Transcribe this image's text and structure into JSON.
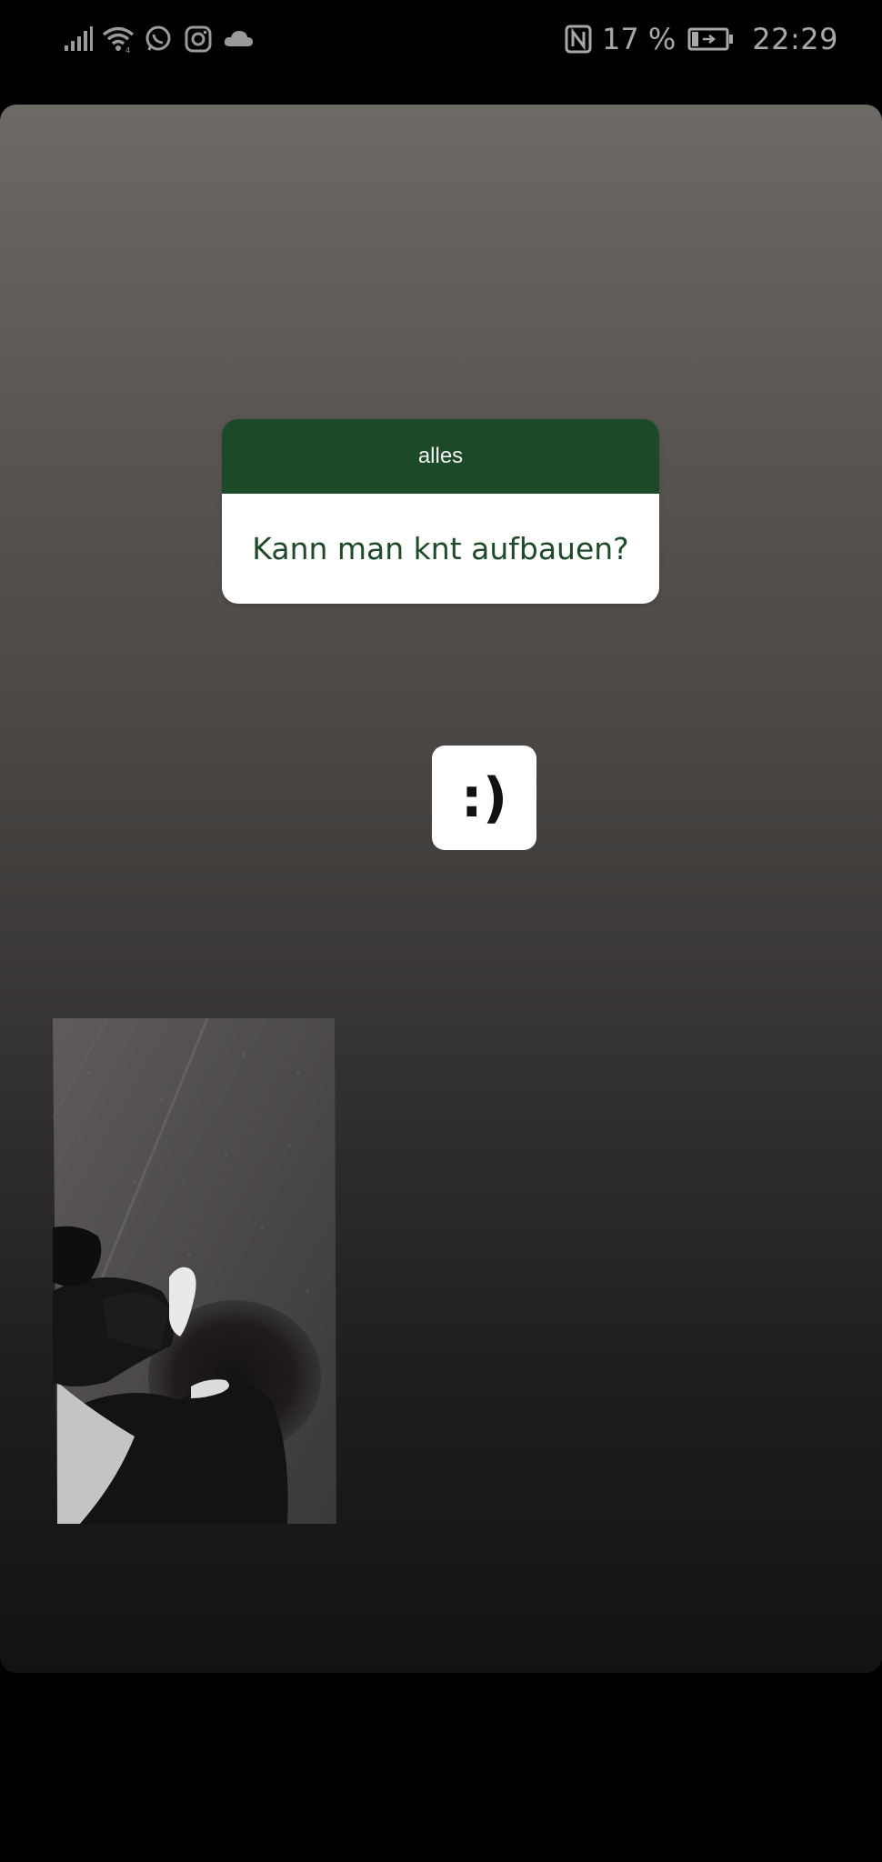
{
  "status_bar": {
    "battery": "17 %",
    "time": "22:29",
    "icons_left": [
      "signal-icon",
      "wifi-icon",
      "whatsapp-icon",
      "instagram-icon",
      "cloud-icon"
    ],
    "icons_right": [
      "nfc-icon",
      "battery-charging-icon"
    ]
  },
  "question_sticker": {
    "header": "alles",
    "question": "Kann man knt aufbauen?",
    "header_color": "#1c4a28",
    "text_color": "#1f4a2a"
  },
  "smiley_sticker": {
    "text": ":)"
  },
  "photo": {
    "subject": "feet-on-wet-asphalt"
  }
}
